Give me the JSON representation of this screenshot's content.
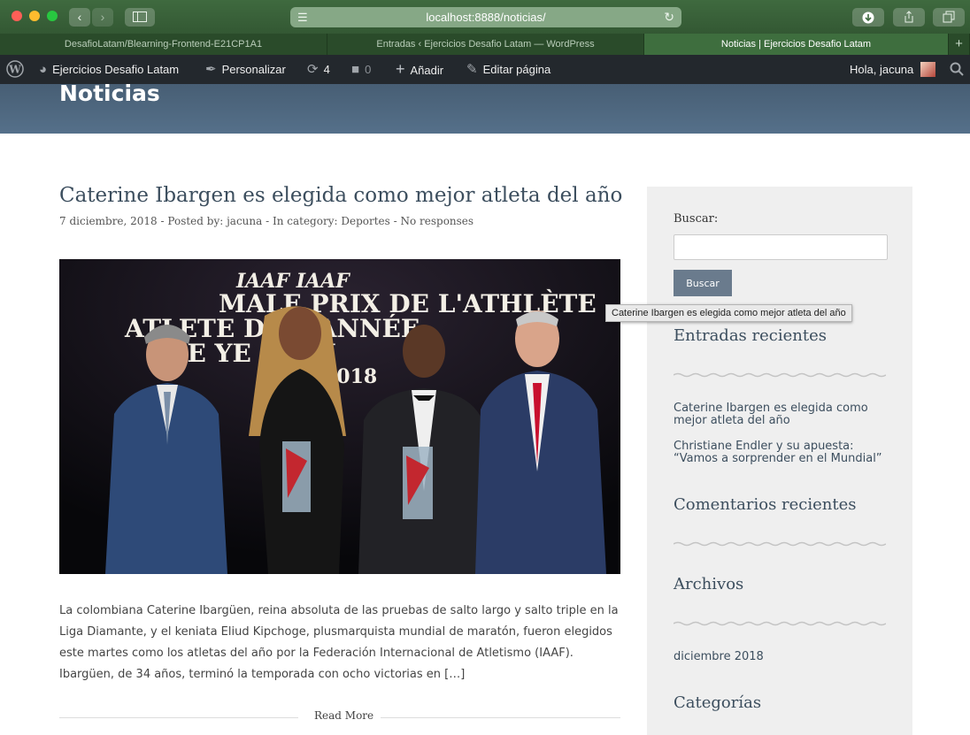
{
  "browser": {
    "url": "localhost:8888/noticias/",
    "tabs": [
      {
        "label": "DesafioLatam/Blearning-Frontend-E21CP1A1",
        "active": false
      },
      {
        "label": "Entradas ‹ Ejercicios Desafio Latam — WordPress",
        "active": false
      },
      {
        "label": "Noticias | Ejercicios Desafio Latam",
        "active": true
      }
    ],
    "new_tab_label": "+"
  },
  "adminbar": {
    "site_name": "Ejercicios Desafio Latam",
    "customize": "Personalizar",
    "updates_count": "4",
    "comments_count": "0",
    "add_new": "Añadir",
    "edit_page": "Editar página",
    "greeting": "Hola, jacuna"
  },
  "page": {
    "title": "Noticias"
  },
  "post": {
    "title": "Caterine Ibargen es elegida como mejor atleta del año",
    "meta": "7 diciembre, 2018 - Posted by: jacuna - In category: Deportes - No responses",
    "image_text_lines": [
      "IAAF  IAAF",
      "MALE PRIX DE L'ATHLÈTE",
      "ATLETE     DE L'ANNÉE",
      "HE YE    OMM",
      "2018"
    ],
    "excerpt": "La colombiana Caterine Ibargüen, reina absoluta de las pruebas de salto largo y salto triple en la Liga Diamante, y el keniata Eliud Kipchoge, plusmarquista mundial de maratón, fueron elegidos este martes como los atletas del año por la Federación Internacional de Atletismo (IAAF). Ibargüen, de 34 años, terminó la temporada con ocho victorias en […]",
    "read_more": "Read More"
  },
  "sidebar": {
    "search_label": "Buscar:",
    "search_value": "",
    "search_button": "Buscar",
    "recent_posts_title": "Entradas recientes",
    "recent_posts": [
      "Caterine Ibargen es elegida como mejor atleta del año",
      "Christiane Endler y su apuesta: “Vamos a sorprender en el Mundial”"
    ],
    "recent_comments_title": "Comentarios recientes",
    "archives_title": "Archivos",
    "archives": [
      "diciembre 2018"
    ],
    "categories_title": "Categorías"
  },
  "tooltip": "Caterine Ibargen es elegida como mejor atleta del año",
  "colors": {
    "titlebar": "#3f6a3f",
    "adminbar": "#23282d",
    "header": "#4d6680",
    "accent_text": "#3c4e5e",
    "button": "#6a7b8d"
  }
}
